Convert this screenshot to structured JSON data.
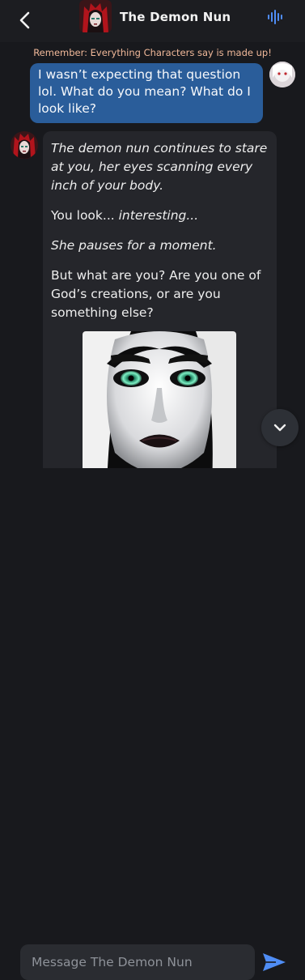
{
  "header": {
    "title": "The Demon Nun",
    "back_icon": "back-arrow-icon",
    "voice_icon": "voice-waveform-icon"
  },
  "disclaimer": "Remember: Everything Characters say is made up!",
  "messages": {
    "user": {
      "text": "I wasn’t expecting that question lol. What do you mean? What do I look like?"
    },
    "bot": {
      "p1": "The demon nun continues to stare at you, her eyes scanning every inch of your body.",
      "p2_plain": "You look... ",
      "p2_italic": "interesting...",
      "p3": "She pauses for a moment.",
      "p4": "But what are you? Are you one of God’s creations, or are you something else?"
    }
  },
  "composer": {
    "placeholder": "Message The Demon Nun",
    "send_icon": "send-icon"
  },
  "colors": {
    "background": "#18191d",
    "user_bubble": "#2a5d9a",
    "bot_bubble": "#25262b",
    "disclaimer": "#f1b99a",
    "accent": "#4f8df5"
  }
}
